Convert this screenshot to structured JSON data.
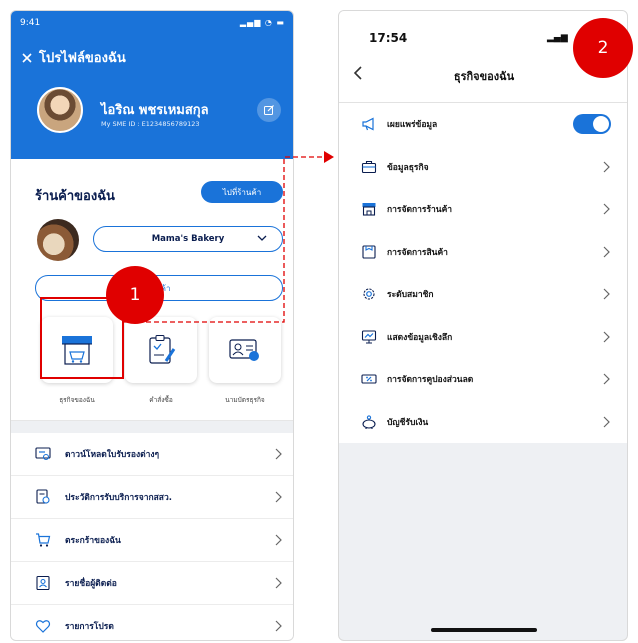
{
  "left": {
    "status_time": "9:41",
    "title": "โปรไฟล์ของฉัน",
    "user_name": "ไอริณ พชรเหมสกุล",
    "user_id": "My SME ID : E1234856789123",
    "shop_title": "ร้านค้าของฉัน",
    "goto_shop": "ไปที่ร้านค้า",
    "shop_select": "Mama's Bakery",
    "wide_button": "...นค้า",
    "tiles": [
      {
        "label": "ธุรกิจของฉัน"
      },
      {
        "label": "คำสั่งซื้อ"
      },
      {
        "label": "นามบัตรธุรกิจ"
      }
    ],
    "menu": [
      {
        "label": "ดาวน์โหลดใบรับรองต่างๆ"
      },
      {
        "label": "ประวัติการรับบริการจากสสว."
      },
      {
        "label": "ตระกร้าของฉัน"
      },
      {
        "label": "รายชื่อผู้ติดต่อ"
      },
      {
        "label": "รายการโปรด"
      }
    ]
  },
  "right": {
    "status_time": "17:54",
    "title": "ธุรกิจของฉัน",
    "items": [
      {
        "label": "เผยแพร่ข้อมูล"
      },
      {
        "label": "ข้อมูลธุรกิจ"
      },
      {
        "label": "การจัดการร้านค้า"
      },
      {
        "label": "การจัดการสินค้า"
      },
      {
        "label": "ระดับสมาชิก"
      },
      {
        "label": "แสดงข้อมูลเชิงลึก"
      },
      {
        "label": "การจัดการคูปองส่วนลด"
      },
      {
        "label": "บัญชีรับเงิน"
      }
    ],
    "publish_toggle_on": true
  },
  "annotations": {
    "step1": "1",
    "step2": "2"
  },
  "colors": {
    "primary": "#1a73d9",
    "annotation": "#e00000",
    "navy": "#0a1d4f"
  }
}
